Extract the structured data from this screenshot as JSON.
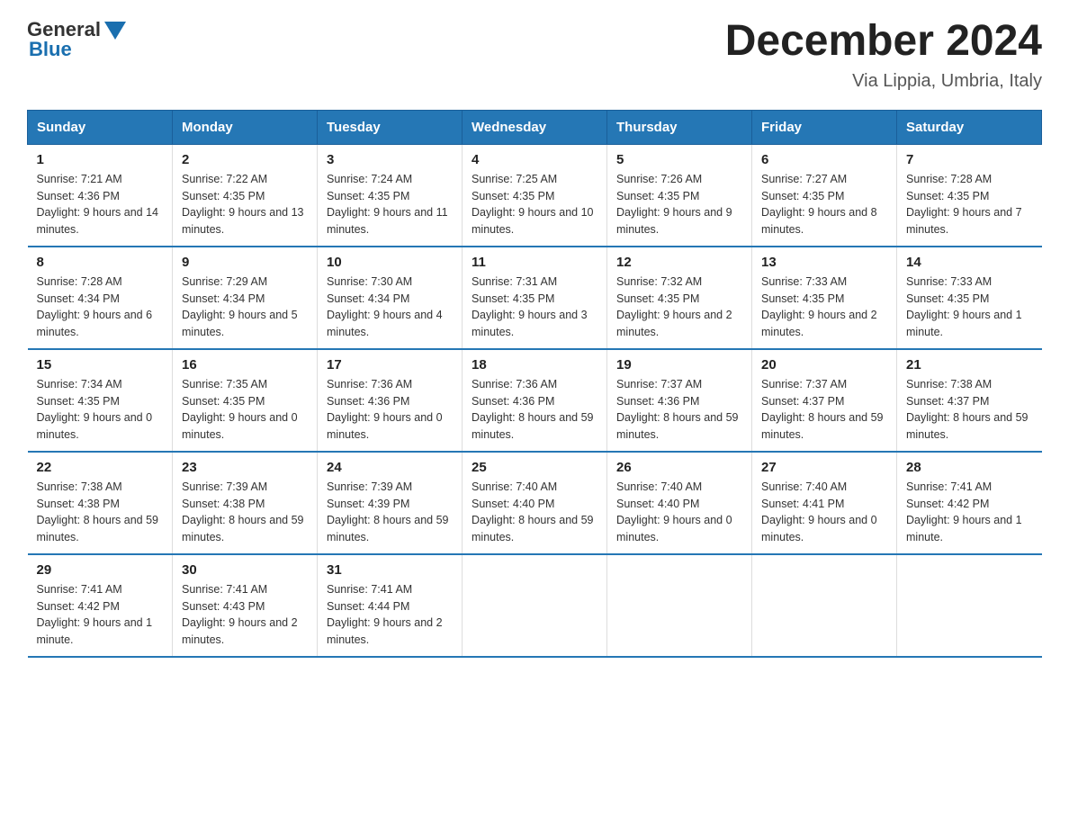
{
  "logo": {
    "general": "General",
    "blue": "Blue"
  },
  "title": "December 2024",
  "subtitle": "Via Lippia, Umbria, Italy",
  "weekdays": [
    "Sunday",
    "Monday",
    "Tuesday",
    "Wednesday",
    "Thursday",
    "Friday",
    "Saturday"
  ],
  "weeks": [
    [
      {
        "day": "1",
        "sunrise": "7:21 AM",
        "sunset": "4:36 PM",
        "daylight": "9 hours and 14 minutes."
      },
      {
        "day": "2",
        "sunrise": "7:22 AM",
        "sunset": "4:35 PM",
        "daylight": "9 hours and 13 minutes."
      },
      {
        "day": "3",
        "sunrise": "7:24 AM",
        "sunset": "4:35 PM",
        "daylight": "9 hours and 11 minutes."
      },
      {
        "day": "4",
        "sunrise": "7:25 AM",
        "sunset": "4:35 PM",
        "daylight": "9 hours and 10 minutes."
      },
      {
        "day": "5",
        "sunrise": "7:26 AM",
        "sunset": "4:35 PM",
        "daylight": "9 hours and 9 minutes."
      },
      {
        "day": "6",
        "sunrise": "7:27 AM",
        "sunset": "4:35 PM",
        "daylight": "9 hours and 8 minutes."
      },
      {
        "day": "7",
        "sunrise": "7:28 AM",
        "sunset": "4:35 PM",
        "daylight": "9 hours and 7 minutes."
      }
    ],
    [
      {
        "day": "8",
        "sunrise": "7:28 AM",
        "sunset": "4:34 PM",
        "daylight": "9 hours and 6 minutes."
      },
      {
        "day": "9",
        "sunrise": "7:29 AM",
        "sunset": "4:34 PM",
        "daylight": "9 hours and 5 minutes."
      },
      {
        "day": "10",
        "sunrise": "7:30 AM",
        "sunset": "4:34 PM",
        "daylight": "9 hours and 4 minutes."
      },
      {
        "day": "11",
        "sunrise": "7:31 AM",
        "sunset": "4:35 PM",
        "daylight": "9 hours and 3 minutes."
      },
      {
        "day": "12",
        "sunrise": "7:32 AM",
        "sunset": "4:35 PM",
        "daylight": "9 hours and 2 minutes."
      },
      {
        "day": "13",
        "sunrise": "7:33 AM",
        "sunset": "4:35 PM",
        "daylight": "9 hours and 2 minutes."
      },
      {
        "day": "14",
        "sunrise": "7:33 AM",
        "sunset": "4:35 PM",
        "daylight": "9 hours and 1 minute."
      }
    ],
    [
      {
        "day": "15",
        "sunrise": "7:34 AM",
        "sunset": "4:35 PM",
        "daylight": "9 hours and 0 minutes."
      },
      {
        "day": "16",
        "sunrise": "7:35 AM",
        "sunset": "4:35 PM",
        "daylight": "9 hours and 0 minutes."
      },
      {
        "day": "17",
        "sunrise": "7:36 AM",
        "sunset": "4:36 PM",
        "daylight": "9 hours and 0 minutes."
      },
      {
        "day": "18",
        "sunrise": "7:36 AM",
        "sunset": "4:36 PM",
        "daylight": "8 hours and 59 minutes."
      },
      {
        "day": "19",
        "sunrise": "7:37 AM",
        "sunset": "4:36 PM",
        "daylight": "8 hours and 59 minutes."
      },
      {
        "day": "20",
        "sunrise": "7:37 AM",
        "sunset": "4:37 PM",
        "daylight": "8 hours and 59 minutes."
      },
      {
        "day": "21",
        "sunrise": "7:38 AM",
        "sunset": "4:37 PM",
        "daylight": "8 hours and 59 minutes."
      }
    ],
    [
      {
        "day": "22",
        "sunrise": "7:38 AM",
        "sunset": "4:38 PM",
        "daylight": "8 hours and 59 minutes."
      },
      {
        "day": "23",
        "sunrise": "7:39 AM",
        "sunset": "4:38 PM",
        "daylight": "8 hours and 59 minutes."
      },
      {
        "day": "24",
        "sunrise": "7:39 AM",
        "sunset": "4:39 PM",
        "daylight": "8 hours and 59 minutes."
      },
      {
        "day": "25",
        "sunrise": "7:40 AM",
        "sunset": "4:40 PM",
        "daylight": "8 hours and 59 minutes."
      },
      {
        "day": "26",
        "sunrise": "7:40 AM",
        "sunset": "4:40 PM",
        "daylight": "9 hours and 0 minutes."
      },
      {
        "day": "27",
        "sunrise": "7:40 AM",
        "sunset": "4:41 PM",
        "daylight": "9 hours and 0 minutes."
      },
      {
        "day": "28",
        "sunrise": "7:41 AM",
        "sunset": "4:42 PM",
        "daylight": "9 hours and 1 minute."
      }
    ],
    [
      {
        "day": "29",
        "sunrise": "7:41 AM",
        "sunset": "4:42 PM",
        "daylight": "9 hours and 1 minute."
      },
      {
        "day": "30",
        "sunrise": "7:41 AM",
        "sunset": "4:43 PM",
        "daylight": "9 hours and 2 minutes."
      },
      {
        "day": "31",
        "sunrise": "7:41 AM",
        "sunset": "4:44 PM",
        "daylight": "9 hours and 2 minutes."
      },
      null,
      null,
      null,
      null
    ]
  ]
}
